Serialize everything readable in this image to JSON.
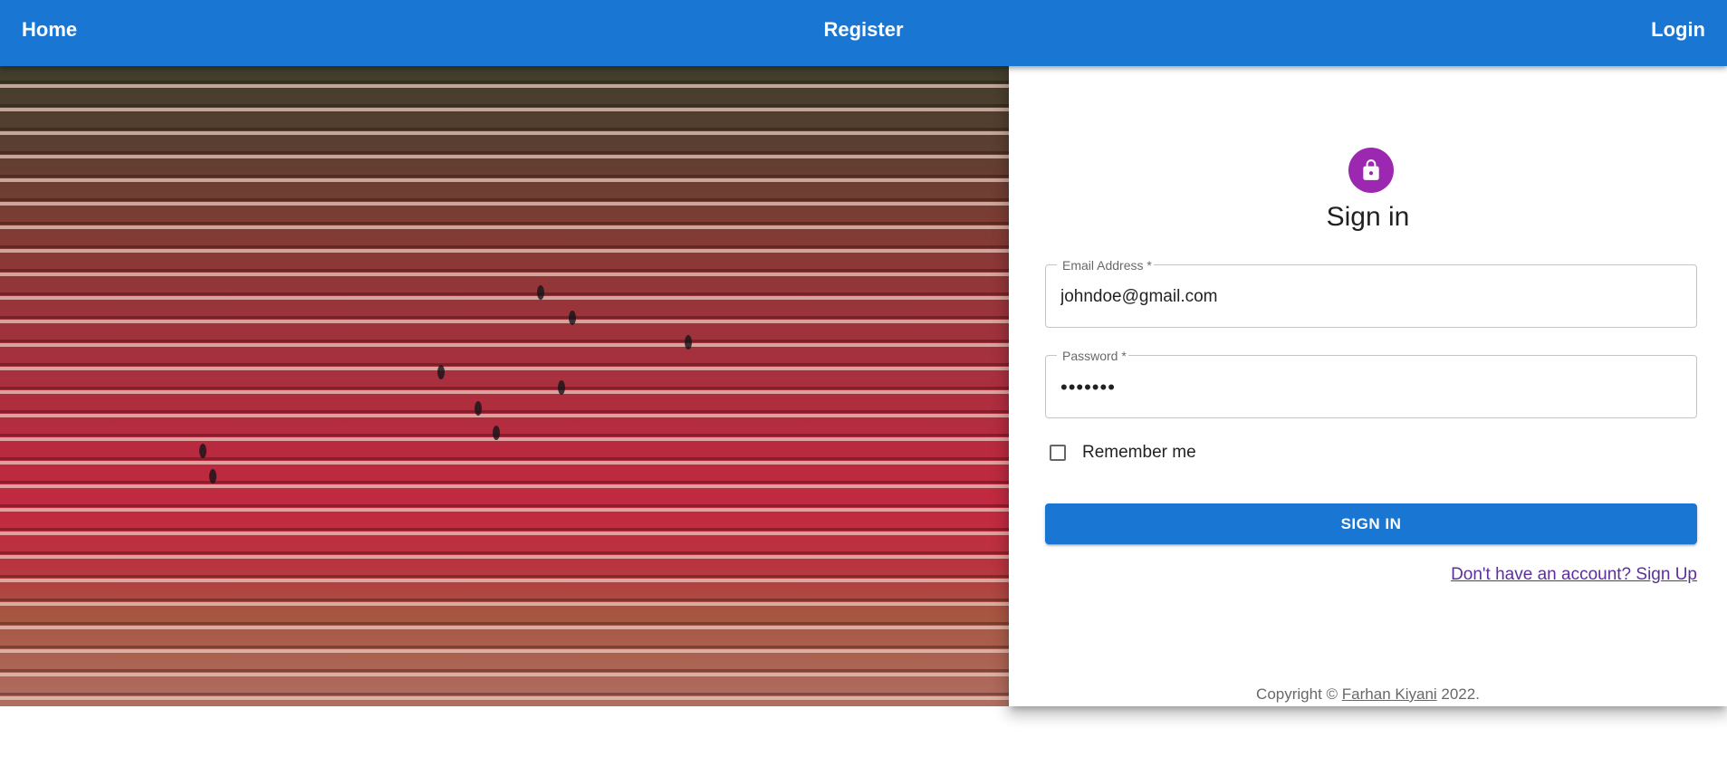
{
  "nav": {
    "home": "Home",
    "register": "Register",
    "login": "Login"
  },
  "hero": {
    "image": "aerial view of tulip field rows with workers"
  },
  "signin": {
    "icon": "lock-icon",
    "title": "Sign in",
    "email": {
      "label": "Email Address *",
      "value": "johndoe@gmail.com"
    },
    "password": {
      "label": "Password *",
      "value": "1234567"
    },
    "remember_label": "Remember me",
    "remember_checked": false,
    "submit_label": "SIGN IN",
    "signup_link": "Don't have an account? Sign Up"
  },
  "footer": {
    "prefix": "Copyright © ",
    "author": "Farhan Kiyani",
    "suffix": " 2022."
  },
  "colors": {
    "primary": "#1976d2",
    "avatar": "#9c27b0",
    "link_visited": "#5d2f9d"
  }
}
